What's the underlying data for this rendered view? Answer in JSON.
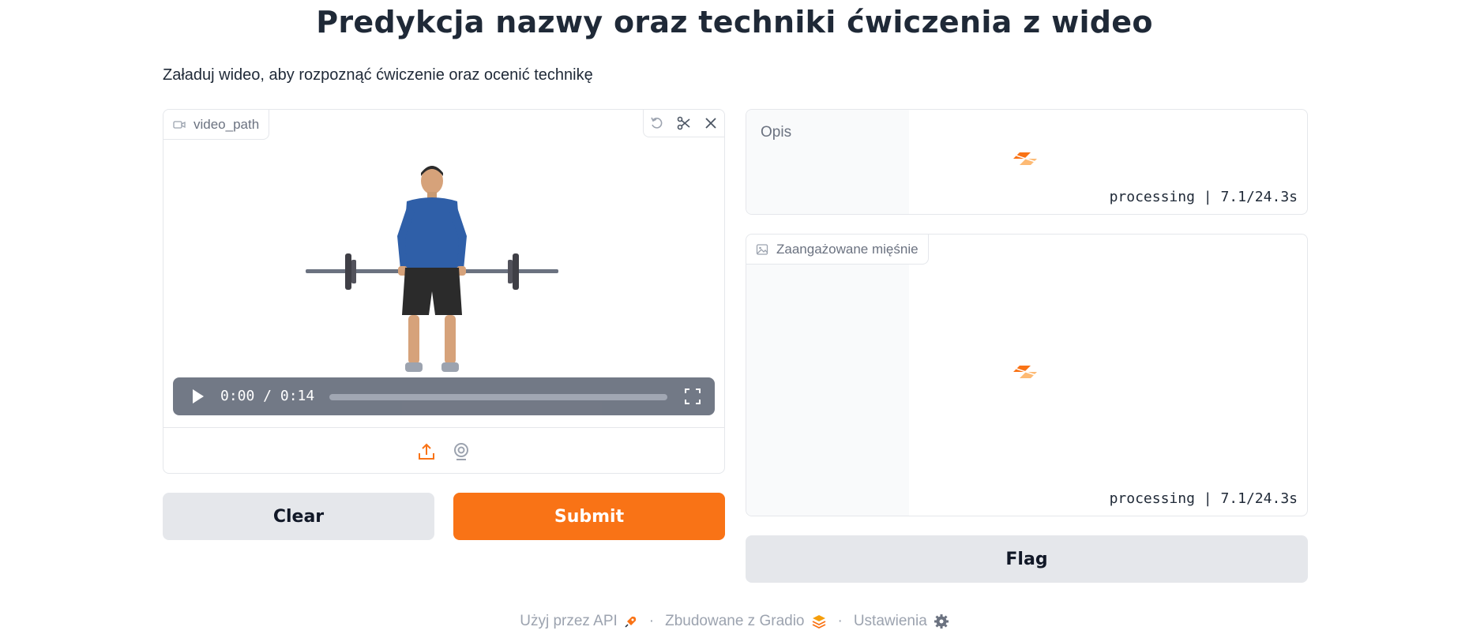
{
  "page": {
    "title": "Predykcja nazwy oraz techniki ćwiczenia z wideo",
    "subtitle": "Załaduj wideo, aby rozpoznąć ćwiczenie oraz ocenić technikę"
  },
  "video_input": {
    "label": "video_path",
    "time": "0:00 / 0:14",
    "tools": [
      "undo-icon",
      "scissors-icon",
      "close-icon"
    ],
    "sources": [
      "upload-icon",
      "webcam-icon"
    ]
  },
  "buttons": {
    "clear": "Clear",
    "submit": "Submit",
    "flag": "Flag"
  },
  "outputs": {
    "description": {
      "label": "Opis",
      "status": "processing | 7.1/24.3s"
    },
    "muscles": {
      "label": "Zaangażowane mięśnie",
      "status": "processing | 7.1/24.3s"
    }
  },
  "footer": {
    "api": "Użyj przez API",
    "built": "Zbudowane z Gradio",
    "settings": "Ustawienia"
  },
  "colors": {
    "accent": "#f97316",
    "secondary": "#e5e7eb",
    "text": "#1f2937",
    "muted": "#9ca3af"
  }
}
